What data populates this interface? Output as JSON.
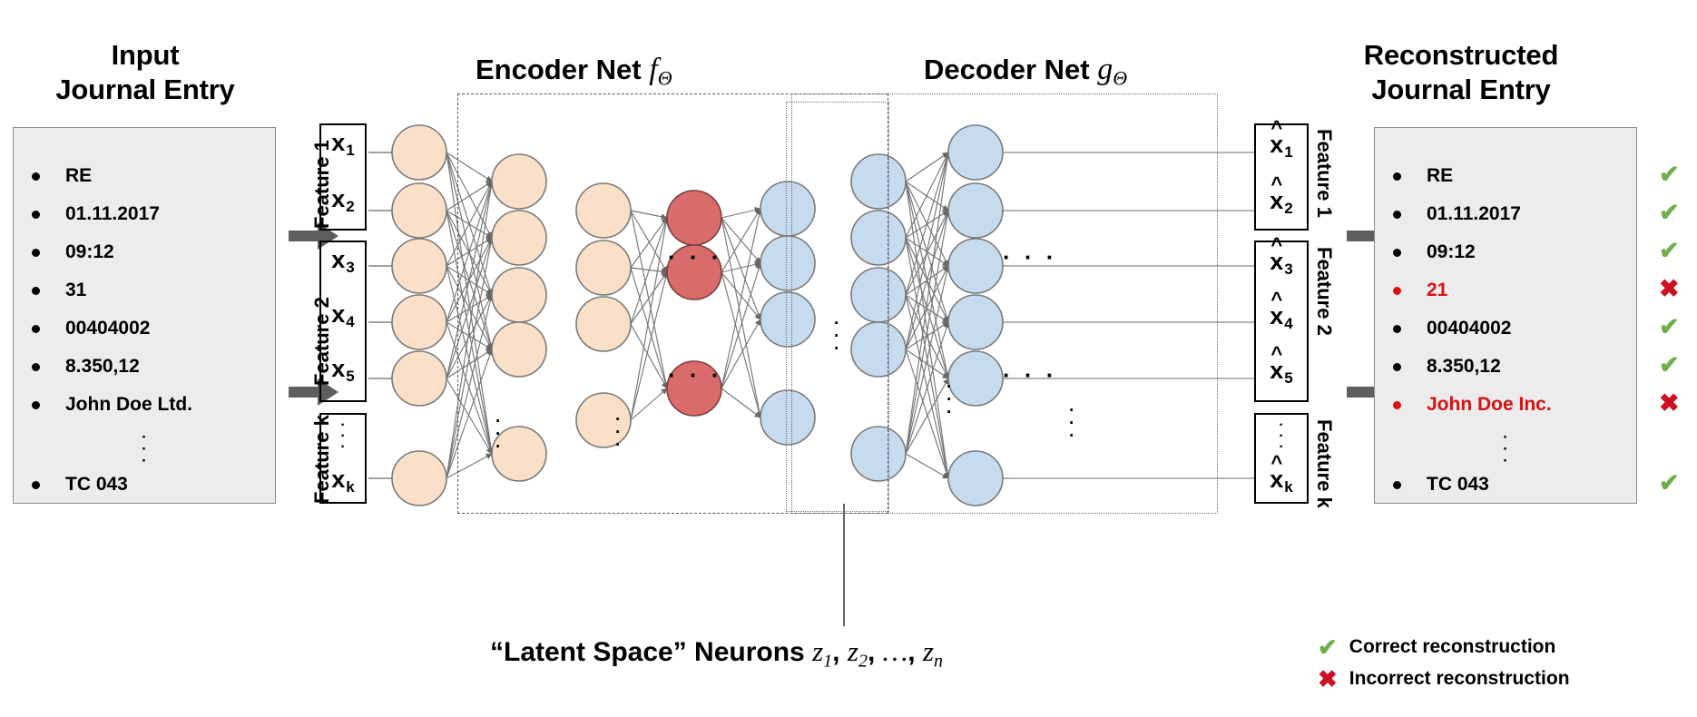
{
  "titles": {
    "input": "Input\nJournal Entry",
    "input_line1": "Input",
    "input_line2": "Journal Entry",
    "output_line1": "Reconstructed",
    "output_line2": "Journal Entry",
    "encoder_text": "Encoder Net",
    "encoder_symbol": "f",
    "encoder_subscript": "Θ",
    "decoder_text": "Decoder Net",
    "decoder_symbol": "g",
    "decoder_subscript": "Θ"
  },
  "input_entry": {
    "items": [
      "RE",
      "01.11.2017",
      "09:12",
      "31",
      "00404002",
      "8.350,12",
      "John Doe Ltd."
    ],
    "ellipsis": "·\n·\n·",
    "last_item": "TC 043"
  },
  "output_entry": {
    "items": [
      {
        "text": "RE",
        "status": "correct"
      },
      {
        "text": "01.11.2017",
        "status": "correct"
      },
      {
        "text": "09:12",
        "status": "correct"
      },
      {
        "text": "21",
        "status": "incorrect"
      },
      {
        "text": "00404002",
        "status": "correct"
      },
      {
        "text": "8.350,12",
        "status": "correct"
      },
      {
        "text": "John Doe Inc.",
        "status": "incorrect"
      }
    ],
    "ellipsis": "·\n·\n·",
    "last_item": {
      "text": "TC 043",
      "status": "correct"
    }
  },
  "input_vectors": [
    {
      "feature": "Feature 1",
      "items": [
        "x1",
        "x2"
      ]
    },
    {
      "feature": "Feature 2",
      "items": [
        "x3",
        "x4",
        "x5"
      ]
    },
    {
      "feature": "Feature k",
      "items": [
        "xk"
      ],
      "dots": true
    }
  ],
  "output_vectors": [
    {
      "feature": "Feature 1",
      "items": [
        "x1",
        "x2"
      ]
    },
    {
      "feature": "Feature 2",
      "items": [
        "x3",
        "x4",
        "x5"
      ]
    },
    {
      "feature": "Feature k",
      "items": [
        "xk"
      ],
      "dots": true
    }
  ],
  "vector_labels": {
    "x1": "x",
    "x1_sub": "1",
    "x2": "x",
    "x2_sub": "2",
    "x3": "x",
    "x3_sub": "3",
    "x4": "x",
    "x4_sub": "4",
    "x5": "x",
    "x5_sub": "5",
    "xk": "x",
    "xk_sub": "k"
  },
  "caption": {
    "quoted": "“Latent Space” Neurons",
    "z1": "z",
    "z1_sub": "1",
    "z2": "z",
    "z2_sub": "2",
    "ellipsis": "…",
    "zn": "z",
    "zn_sub": "n",
    "full": "“Latent Space” Neurons z1, z2, …, zn"
  },
  "legend": {
    "correct_mark": "✔",
    "correct_label": "Correct reconstruction",
    "incorrect_mark": "✖",
    "incorrect_label": "Incorrect reconstruction"
  },
  "marks": {
    "correct": "✔",
    "incorrect": "✖"
  },
  "colors": {
    "encoder_neuron": "#fae0c8",
    "encoder_neuron_stroke": "#7a7a7a",
    "latent_neuron": "#d96b6b",
    "latent_neuron_stroke": "#7a4040",
    "decoder_neuron": "#c6dcee",
    "decoder_neuron_stroke": "#7a7a7a",
    "box_fill": "#ececec",
    "box_stroke": "#8a8a8a",
    "correct_green": "#6fae4d",
    "incorrect_red": "#cc1122",
    "error_text_red": "#d81111",
    "arrow_grey": "#5a5a5a",
    "block_arrow_grey": "#5e5e5e"
  },
  "network": {
    "encoder_layers": [
      7,
      5,
      4
    ],
    "latent_layer": 3,
    "decoder_layers": [
      5,
      6,
      7
    ],
    "description": "Fully-connected autoencoder: encoder narrows to latent space, decoder widens back"
  }
}
